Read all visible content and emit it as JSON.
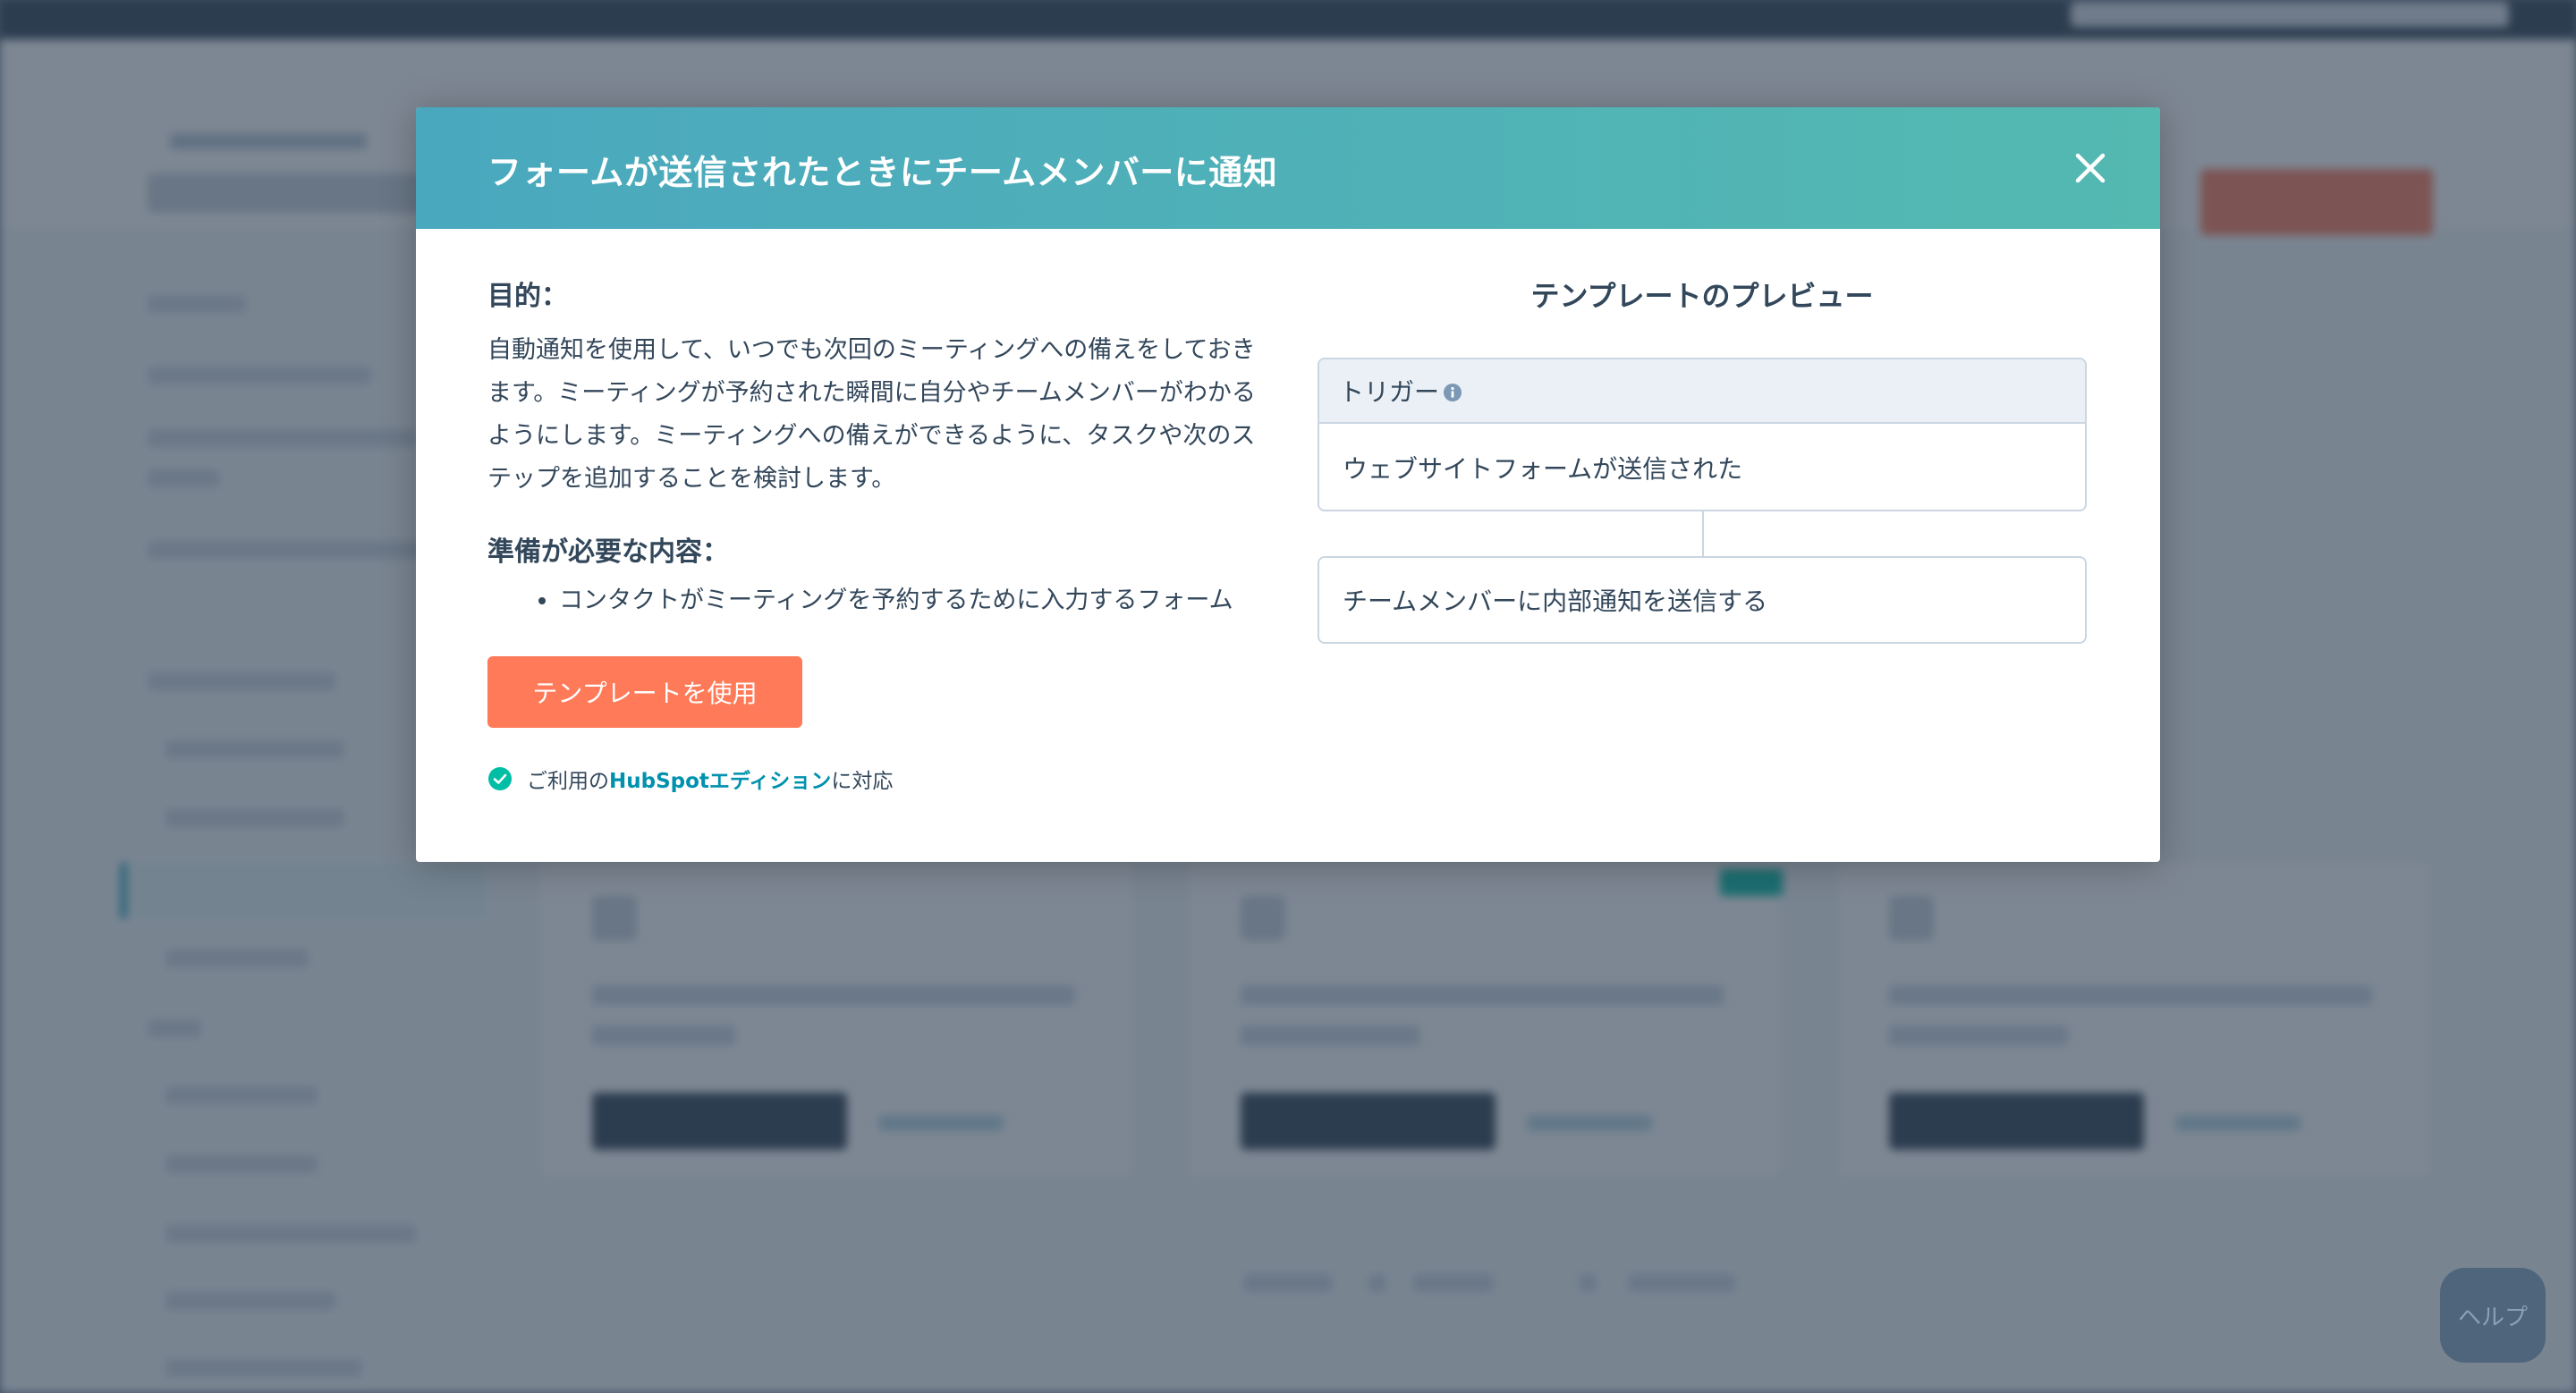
{
  "modal": {
    "title": "フォームが送信されたときにチームメンバーに通知",
    "purpose_heading": "目的：",
    "purpose_text": "自動通知を使用して、いつでも次回のミーティングへの備えをしておきます。ミーティングが予約された瞬間に自分やチームメンバーがわかるようにします。ミーティングへの備えができるように、タスクや次のステップを追加することを検討します。",
    "needs_heading": "準備が必要な内容：",
    "needs_items": [
      "コンタクトがミーティングを予約するために入力するフォーム"
    ],
    "use_template_label": "テンプレートを使用",
    "edition_prefix": "ご利用の",
    "edition_link": "HubSpotエディション",
    "edition_suffix": "に対応",
    "preview_title": "テンプレートのプレビュー",
    "trigger_label": "トリガー",
    "trigger_value": "ウェブサイトフォームが送信された",
    "action_value": "チームメンバーに内部通知を送信する"
  },
  "help_label": "ヘルプ",
  "icons": {
    "close": "close-icon",
    "check": "check-circle-icon",
    "info": "info-icon"
  },
  "colors": {
    "header_gradient_start": "#4aa8be",
    "header_gradient_end": "#54b9b1",
    "primary_button": "#ff7a59",
    "link": "#0091ae",
    "success": "#00bda5",
    "text": "#33475b"
  }
}
